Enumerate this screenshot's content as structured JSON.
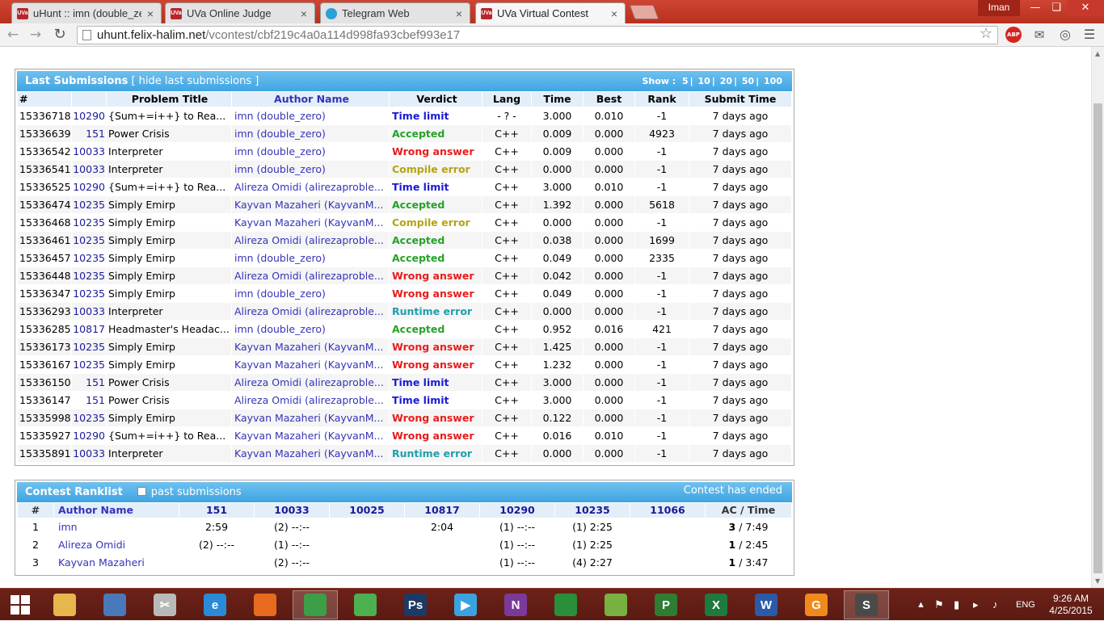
{
  "browser": {
    "tabs": [
      {
        "label": "uHunt :: imn (double_zero",
        "icon": "uva-icon",
        "favtext": "UVa",
        "active": false
      },
      {
        "label": "UVa Online Judge",
        "icon": "uva-icon",
        "favtext": "UVa",
        "active": false
      },
      {
        "label": "Telegram Web",
        "icon": "telegram-icon",
        "favtext": "",
        "active": false
      },
      {
        "label": "UVa Virtual Contest",
        "icon": "uva-icon",
        "favtext": "UVa",
        "active": true
      }
    ],
    "user": "Iman",
    "url_host": "uhunt.felix-halim.net",
    "url_path": "/vcontest/cbf219c4a0a114d998fa93cbef993e17",
    "abp": "ABP",
    "accent_color": "#c0392b"
  },
  "submissions": {
    "title": "Last Submissions",
    "hide_link": "[ hide last submissions ]",
    "show_label": "Show :",
    "show_options": [
      "5",
      "10",
      "20",
      "50",
      "100"
    ],
    "headers": {
      "id": "#",
      "pnum": "",
      "title": "Problem Title",
      "author": "Author Name",
      "verdict": "Verdict",
      "lang": "Lang",
      "time": "Time",
      "best": "Best",
      "rank": "Rank",
      "submit": "Submit Time"
    },
    "rows": [
      {
        "id": "15336718",
        "pnum": "10290",
        "title": "{Sum+=i++} to Rea...",
        "author": "imn (double_zero)",
        "verdict": "Time limit",
        "vclass": "v-tle",
        "lang": "- ? -",
        "time": "3.000",
        "best": "0.010",
        "rank": "-1",
        "submit": "7 days ago"
      },
      {
        "id": "15336639",
        "pnum": "151",
        "title": "Power Crisis",
        "author": "imn (double_zero)",
        "verdict": "Accepted",
        "vclass": "v-ac",
        "lang": "C++",
        "time": "0.009",
        "best": "0.000",
        "rank": "4923",
        "submit": "7 days ago"
      },
      {
        "id": "15336542",
        "pnum": "10033",
        "title": "Interpreter",
        "author": "imn (double_zero)",
        "verdict": "Wrong answer",
        "vclass": "v-wa",
        "lang": "C++",
        "time": "0.009",
        "best": "0.000",
        "rank": "-1",
        "submit": "7 days ago"
      },
      {
        "id": "15336541",
        "pnum": "10033",
        "title": "Interpreter",
        "author": "imn (double_zero)",
        "verdict": "Compile error",
        "vclass": "v-ce",
        "lang": "C++",
        "time": "0.000",
        "best": "0.000",
        "rank": "-1",
        "submit": "7 days ago"
      },
      {
        "id": "15336525",
        "pnum": "10290",
        "title": "{Sum+=i++} to Rea...",
        "author": "Alireza Omidi (alirezaproble...",
        "verdict": "Time limit",
        "vclass": "v-tle",
        "lang": "C++",
        "time": "3.000",
        "best": "0.010",
        "rank": "-1",
        "submit": "7 days ago"
      },
      {
        "id": "15336474",
        "pnum": "10235",
        "title": "Simply Emirp",
        "author": "Kayvan Mazaheri (KayvanM...",
        "verdict": "Accepted",
        "vclass": "v-ac",
        "lang": "C++",
        "time": "1.392",
        "best": "0.000",
        "rank": "5618",
        "submit": "7 days ago"
      },
      {
        "id": "15336468",
        "pnum": "10235",
        "title": "Simply Emirp",
        "author": "Kayvan Mazaheri (KayvanM...",
        "verdict": "Compile error",
        "vclass": "v-ce",
        "lang": "C++",
        "time": "0.000",
        "best": "0.000",
        "rank": "-1",
        "submit": "7 days ago"
      },
      {
        "id": "15336461",
        "pnum": "10235",
        "title": "Simply Emirp",
        "author": "Alireza Omidi (alirezaproble...",
        "verdict": "Accepted",
        "vclass": "v-ac",
        "lang": "C++",
        "time": "0.038",
        "best": "0.000",
        "rank": "1699",
        "submit": "7 days ago"
      },
      {
        "id": "15336457",
        "pnum": "10235",
        "title": "Simply Emirp",
        "author": "imn (double_zero)",
        "verdict": "Accepted",
        "vclass": "v-ac",
        "lang": "C++",
        "time": "0.049",
        "best": "0.000",
        "rank": "2335",
        "submit": "7 days ago"
      },
      {
        "id": "15336448",
        "pnum": "10235",
        "title": "Simply Emirp",
        "author": "Alireza Omidi (alirezaproble...",
        "verdict": "Wrong answer",
        "vclass": "v-wa",
        "lang": "C++",
        "time": "0.042",
        "best": "0.000",
        "rank": "-1",
        "submit": "7 days ago"
      },
      {
        "id": "15336347",
        "pnum": "10235",
        "title": "Simply Emirp",
        "author": "imn (double_zero)",
        "verdict": "Wrong answer",
        "vclass": "v-wa",
        "lang": "C++",
        "time": "0.049",
        "best": "0.000",
        "rank": "-1",
        "submit": "7 days ago"
      },
      {
        "id": "15336293",
        "pnum": "10033",
        "title": "Interpreter",
        "author": "Alireza Omidi (alirezaproble...",
        "verdict": "Runtime error",
        "vclass": "v-re",
        "lang": "C++",
        "time": "0.000",
        "best": "0.000",
        "rank": "-1",
        "submit": "7 days ago"
      },
      {
        "id": "15336285",
        "pnum": "10817",
        "title": "Headmaster's Headac...",
        "author": "imn (double_zero)",
        "verdict": "Accepted",
        "vclass": "v-ac",
        "lang": "C++",
        "time": "0.952",
        "best": "0.016",
        "rank": "421",
        "submit": "7 days ago"
      },
      {
        "id": "15336173",
        "pnum": "10235",
        "title": "Simply Emirp",
        "author": "Kayvan Mazaheri (KayvanM...",
        "verdict": "Wrong answer",
        "vclass": "v-wa",
        "lang": "C++",
        "time": "1.425",
        "best": "0.000",
        "rank": "-1",
        "submit": "7 days ago"
      },
      {
        "id": "15336167",
        "pnum": "10235",
        "title": "Simply Emirp",
        "author": "Kayvan Mazaheri (KayvanM...",
        "verdict": "Wrong answer",
        "vclass": "v-wa",
        "lang": "C++",
        "time": "1.232",
        "best": "0.000",
        "rank": "-1",
        "submit": "7 days ago"
      },
      {
        "id": "15336150",
        "pnum": "151",
        "title": "Power Crisis",
        "author": "Alireza Omidi (alirezaproble...",
        "verdict": "Time limit",
        "vclass": "v-tle",
        "lang": "C++",
        "time": "3.000",
        "best": "0.000",
        "rank": "-1",
        "submit": "7 days ago"
      },
      {
        "id": "15336147",
        "pnum": "151",
        "title": "Power Crisis",
        "author": "Alireza Omidi (alirezaproble...",
        "verdict": "Time limit",
        "vclass": "v-tle",
        "lang": "C++",
        "time": "3.000",
        "best": "0.000",
        "rank": "-1",
        "submit": "7 days ago"
      },
      {
        "id": "15335998",
        "pnum": "10235",
        "title": "Simply Emirp",
        "author": "Kayvan Mazaheri (KayvanM...",
        "verdict": "Wrong answer",
        "vclass": "v-wa",
        "lang": "C++",
        "time": "0.122",
        "best": "0.000",
        "rank": "-1",
        "submit": "7 days ago"
      },
      {
        "id": "15335927",
        "pnum": "10290",
        "title": "{Sum+=i++} to Rea...",
        "author": "Kayvan Mazaheri (KayvanM...",
        "verdict": "Wrong answer",
        "vclass": "v-wa",
        "lang": "C++",
        "time": "0.016",
        "best": "0.010",
        "rank": "-1",
        "submit": "7 days ago"
      },
      {
        "id": "15335891",
        "pnum": "10033",
        "title": "Interpreter",
        "author": "Kayvan Mazaheri (KayvanM...",
        "verdict": "Runtime error",
        "vclass": "v-re",
        "lang": "C++",
        "time": "0.000",
        "best": "0.000",
        "rank": "-1",
        "submit": "7 days ago"
      }
    ]
  },
  "ranklist": {
    "title": "Contest Ranklist",
    "past_label": "past submissions",
    "status": "Contest has ended",
    "headers": {
      "num": "#",
      "author": "Author Name",
      "ac": "AC / Time"
    },
    "problems": [
      "151",
      "10033",
      "10025",
      "10817",
      "10290",
      "10235",
      "11066"
    ],
    "rows": [
      {
        "rank": "1",
        "name": "imn",
        "cells": [
          "2:59",
          "(2) --:--",
          "",
          "2:04",
          "(1) --:--",
          "(1) 2:25",
          ""
        ],
        "ac": "3",
        "time": " / 7:49"
      },
      {
        "rank": "2",
        "name": "Alireza Omidi",
        "cells": [
          "(2) --:--",
          "(1) --:--",
          "",
          "",
          "(1) --:--",
          "(1) 2:25",
          ""
        ],
        "ac": "1",
        "time": " / 2:45"
      },
      {
        "rank": "3",
        "name": "Kayvan Mazaheri",
        "cells": [
          "",
          "(2) --:--",
          "",
          "",
          "(1) --:--",
          "(4) 2:27",
          ""
        ],
        "ac": "1",
        "time": " / 3:47"
      }
    ]
  },
  "taskbar": {
    "apps": [
      {
        "name": "file-explorer-icon",
        "color": "#e7b64c",
        "text": "",
        "active": false
      },
      {
        "name": "control-panel-icon",
        "color": "#4a78b8",
        "text": "",
        "active": false
      },
      {
        "name": "snipping-tool-icon",
        "color": "#b9b9b9",
        "text": "✂",
        "active": false
      },
      {
        "name": "internet-explorer-icon",
        "color": "#2a8ad6",
        "text": "e",
        "active": false
      },
      {
        "name": "firefox-icon",
        "color": "#e86a1f",
        "text": "",
        "active": false
      },
      {
        "name": "chrome-icon",
        "color": "#3c9e47",
        "text": "",
        "active": true
      },
      {
        "name": "greenshot-icon",
        "color": "#4caf50",
        "text": "",
        "active": false
      },
      {
        "name": "photoshop-icon",
        "color": "#1d3a66",
        "text": "Ps",
        "active": false
      },
      {
        "name": "media-player-icon",
        "color": "#3aa3df",
        "text": "▶",
        "active": false
      },
      {
        "name": "onenote-icon",
        "color": "#7a3a9a",
        "text": "N",
        "active": false
      },
      {
        "name": "download-manager-icon",
        "color": "#2a8f3a",
        "text": "",
        "active": false
      },
      {
        "name": "android-studio-icon",
        "color": "#79b042",
        "text": "",
        "active": false
      },
      {
        "name": "project-icon",
        "color": "#2f7d32",
        "text": "P",
        "active": false
      },
      {
        "name": "excel-icon",
        "color": "#1e7a3f",
        "text": "X",
        "active": false
      },
      {
        "name": "word-icon",
        "color": "#2a5aa8",
        "text": "W",
        "active": false
      },
      {
        "name": "foxit-pdf-icon",
        "color": "#f08a1c",
        "text": "G",
        "active": false
      },
      {
        "name": "sublime-text-icon",
        "color": "#4a4a4a",
        "text": "S",
        "active": true
      }
    ],
    "language": "ENG",
    "time": "9:26 AM",
    "date": "4/25/2015"
  }
}
